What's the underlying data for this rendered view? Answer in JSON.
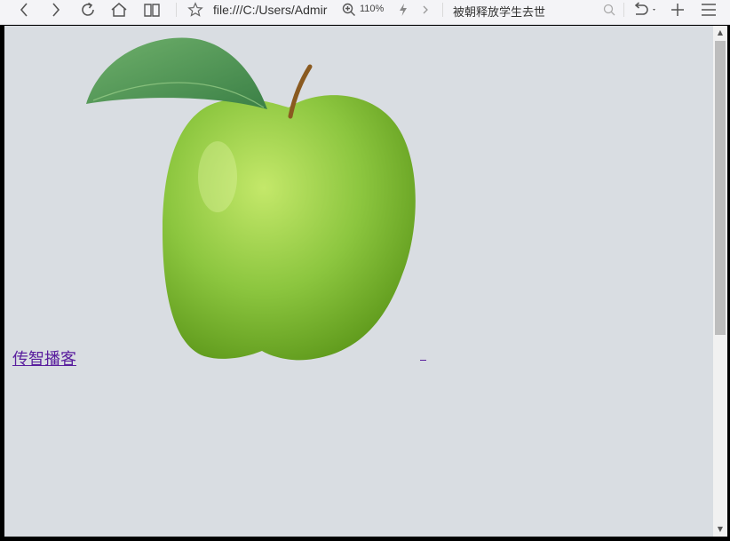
{
  "browser": {
    "address": "file:///C:/Users/Admir",
    "zoom": "110%",
    "search": "被朝释放学生去世",
    "icons": {
      "back": "back-arrow-icon",
      "forward": "forward-arrow-icon",
      "reload": "reload-icon",
      "home": "home-icon",
      "reader": "reader-book-icon",
      "favorite": "star-icon",
      "zoom": "zoom-in-icon",
      "lightning": "lightning-icon",
      "more": "chevron-right-icon",
      "search": "search-icon",
      "undo": "undo-icon",
      "new_tab": "plus-icon",
      "menu": "menu-icon"
    }
  },
  "page": {
    "link_text": "传智播客",
    "image": "green-apple-with-leaf"
  },
  "colors": {
    "link": "#5a1f9e",
    "page_background": "#d9dde2",
    "apple": "#8cc63f",
    "leaf": "#4f9a55"
  }
}
